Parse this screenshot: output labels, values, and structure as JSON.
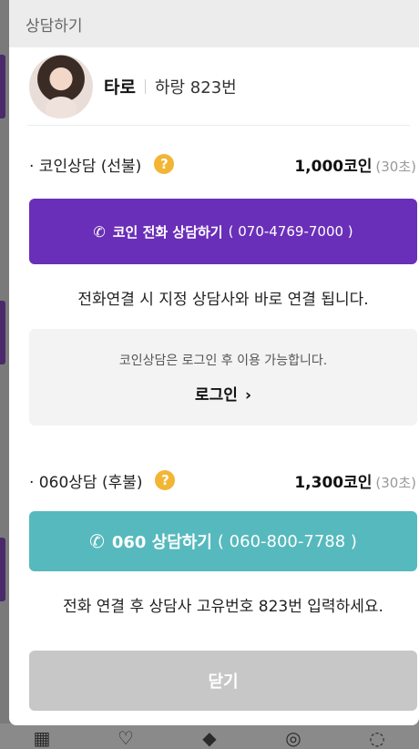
{
  "modal": {
    "title": "상담하기"
  },
  "counselor": {
    "name": "타로",
    "code": "하랑 823번"
  },
  "coin_consult": {
    "title": "· 코인상담 (선불)",
    "help": "?",
    "price": "1,000코인",
    "unit": "(30초)",
    "button_label": "코인 전화 상담하기",
    "button_number": "( 070-4769-7000 )",
    "note": "전화연결 시 지정 상담사와 바로 연결 됩니다."
  },
  "login": {
    "message": "코인상담은 로그인 후 이용 가능합니다.",
    "link_label": "로그인",
    "chevron": "›"
  },
  "postpaid_consult": {
    "title": "· 060상담 (후불)",
    "help": "?",
    "price": "1,300코인",
    "unit": "(30초)",
    "button_label": "060 상담하기",
    "button_number": "( 060-800-7788 )",
    "note": "전화 연결 후 상담사 고유번호 823번 입력하세요."
  },
  "close_button": "닫기",
  "colors": {
    "coin_button": "#6a2fb8",
    "postpaid_button": "#56b9bd",
    "close_button": "#c7c7c7",
    "help_icon": "#f2b534"
  }
}
